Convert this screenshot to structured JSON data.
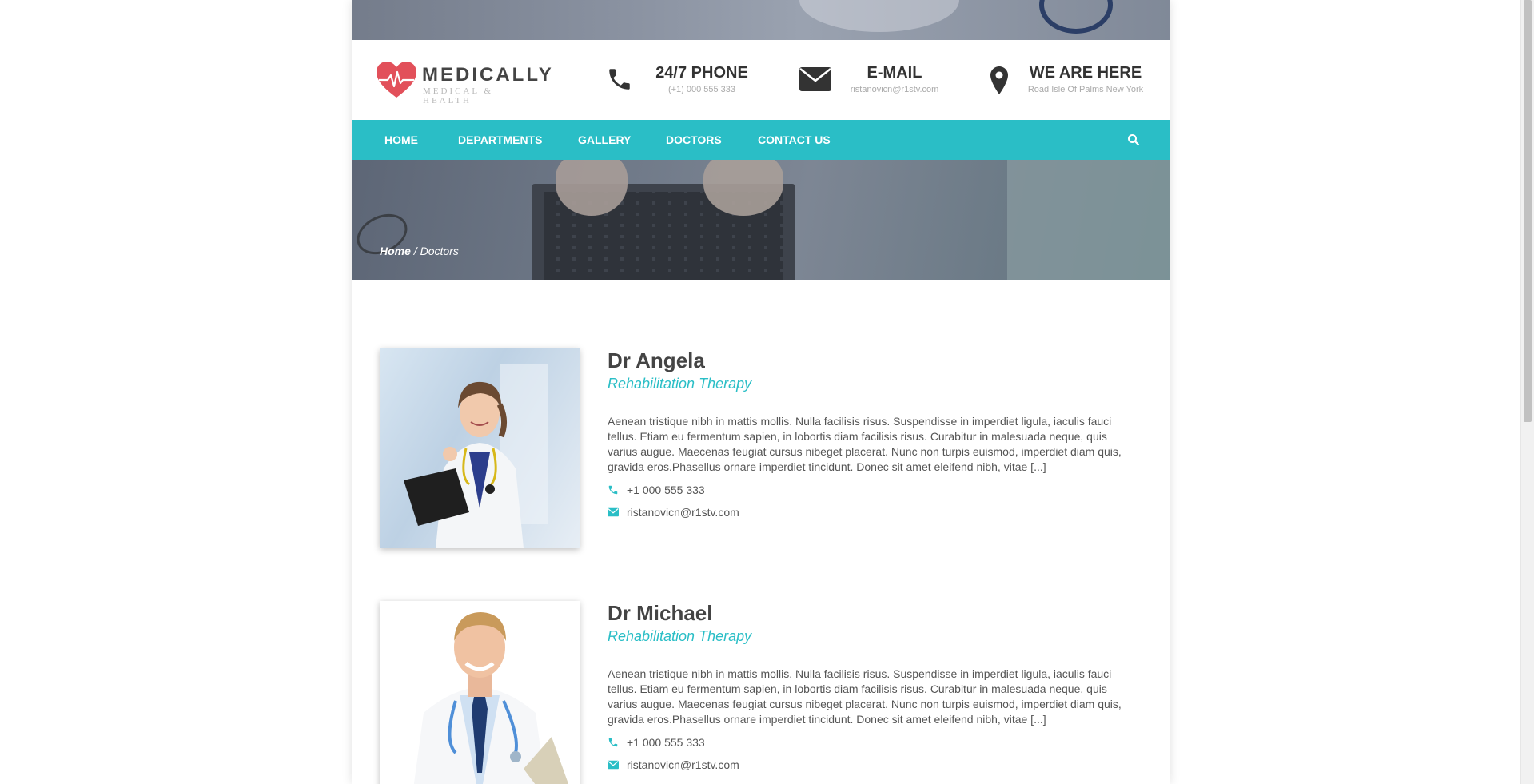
{
  "logo": {
    "name": "MEDICALLY",
    "tagline": "MEDICAL & HEALTH"
  },
  "contacts": {
    "phone": {
      "title": "24/7 PHONE",
      "sub": "(+1) 000 555 333"
    },
    "email": {
      "title": "E-MAIL",
      "sub": "ristanovicn@r1stv.com"
    },
    "location": {
      "title": "WE ARE HERE",
      "sub": "Road Isle Of Palms New York"
    }
  },
  "nav": {
    "items": [
      "HOME",
      "DEPARTMENTS",
      "GALLERY",
      "DOCTORS",
      "CONTACT US"
    ],
    "active": "DOCTORS"
  },
  "breadcrumb": {
    "home": "Home",
    "separator": "/",
    "current": "Doctors"
  },
  "doctors": [
    {
      "name": "Dr Angela",
      "role": "Rehabilitation Therapy",
      "bio": "Aenean tristique nibh in mattis mollis. Nulla facilisis risus. Suspendisse in imperdiet ligula, iaculis fauci tellus. Etiam eu fermentum sapien, in lobortis diam facilisis risus. Curabitur in malesuada neque, quis varius augue. Maecenas feugiat cursus nibeget placerat. Nunc non turpis euismod, imperdiet diam quis, gravida eros.Phasellus ornare imperdiet tincidunt. Donec sit amet eleifend nibh, vitae [...]",
      "phone": "+1 000 555 333",
      "email": "ristanovicn@r1stv.com"
    },
    {
      "name": "Dr Michael",
      "role": "Rehabilitation Therapy",
      "bio": "Aenean tristique nibh in mattis mollis. Nulla facilisis risus. Suspendisse in imperdiet ligula, iaculis fauci tellus. Etiam eu fermentum sapien, in lobortis diam facilisis risus. Curabitur in malesuada neque, quis varius augue. Maecenas feugiat cursus nibeget placerat. Nunc non turpis euismod, imperdiet diam quis, gravida eros.Phasellus ornare imperdiet tincidunt. Donec sit amet eleifend nibh, vitae [...]",
      "phone": "+1 000 555 333",
      "email": "ristanovicn@r1stv.com"
    }
  ],
  "icons": {
    "logo": "heart-pulse-icon",
    "phone": "phone-icon",
    "email": "envelope-icon",
    "location": "map-pin-icon",
    "search": "search-icon"
  },
  "colors": {
    "accent": "#2abec6",
    "logo_heart": "#e2505a",
    "text_dark": "#444444"
  }
}
